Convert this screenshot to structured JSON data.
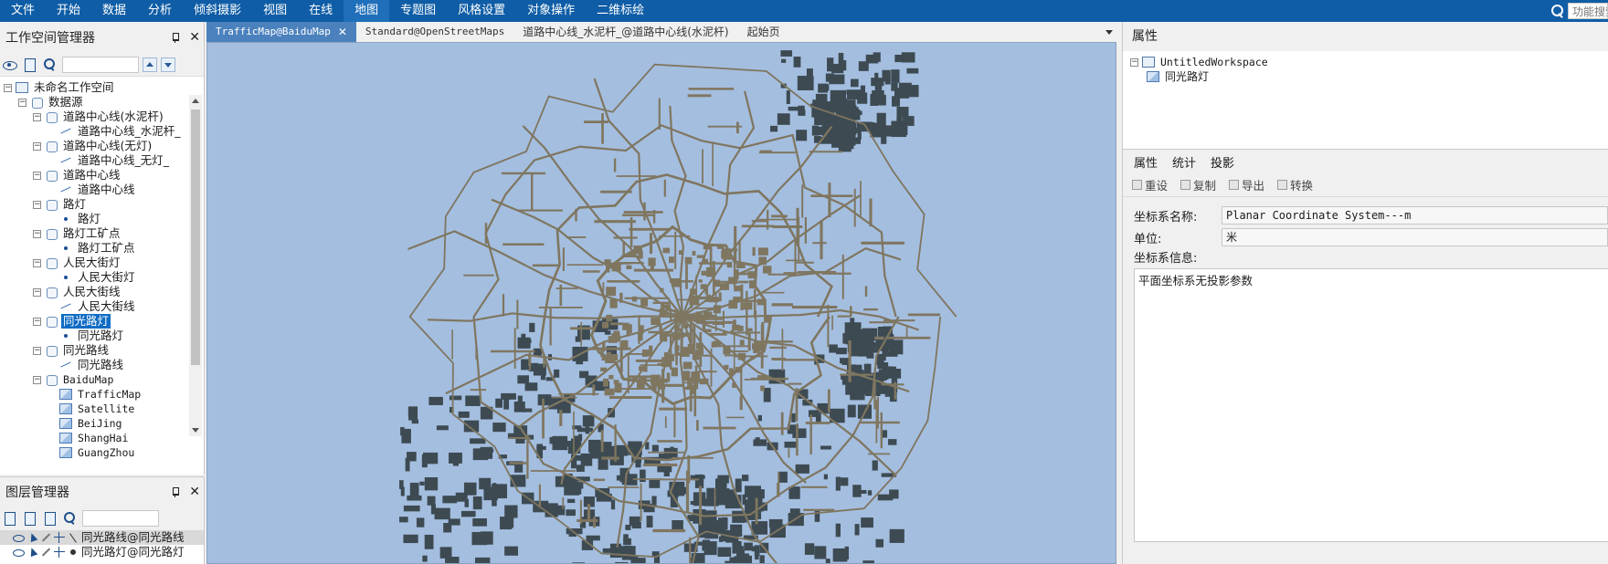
{
  "menubar": {
    "items": [
      "文件",
      "开始",
      "数据",
      "分析",
      "倾斜摄影",
      "视图",
      "在线",
      "地图",
      "专题图",
      "风格设置",
      "对象操作",
      "二维标绘"
    ],
    "active_index": 7,
    "search_placeholder": "功能搜索"
  },
  "workspace_panel": {
    "title": "工作空间管理器",
    "close_glyph": "✕",
    "tree": [
      {
        "level": 0,
        "icon": "workspace-icon",
        "label": "未命名工作空间",
        "expander": "−"
      },
      {
        "level": 1,
        "icon": "datasource-icon",
        "label": "数据源",
        "expander": "−"
      },
      {
        "level": 2,
        "icon": "datasource-icon",
        "label": "道路中心线(水泥杆)",
        "expander": "−"
      },
      {
        "level": 3,
        "icon": "line-dataset-icon",
        "label": "道路中心线_水泥杆_",
        "expander": ""
      },
      {
        "level": 2,
        "icon": "datasource-icon",
        "label": "道路中心线(无灯)",
        "expander": "−"
      },
      {
        "level": 3,
        "icon": "line-dataset-icon",
        "label": "道路中心线_无灯_",
        "expander": ""
      },
      {
        "level": 2,
        "icon": "datasource-icon",
        "label": "道路中心线",
        "expander": "−"
      },
      {
        "level": 3,
        "icon": "line-dataset-icon",
        "label": "道路中心线",
        "expander": ""
      },
      {
        "level": 2,
        "icon": "datasource-icon",
        "label": "路灯",
        "expander": "−"
      },
      {
        "level": 3,
        "icon": "point-dataset-icon",
        "label": "路灯",
        "expander": ""
      },
      {
        "level": 2,
        "icon": "datasource-icon",
        "label": "路灯工矿点",
        "expander": "−"
      },
      {
        "level": 3,
        "icon": "point-dataset-icon",
        "label": "路灯工矿点",
        "expander": ""
      },
      {
        "level": 2,
        "icon": "datasource-icon",
        "label": "人民大街灯",
        "expander": "−"
      },
      {
        "level": 3,
        "icon": "point-dataset-icon",
        "label": "人民大街灯",
        "expander": ""
      },
      {
        "level": 2,
        "icon": "datasource-icon",
        "label": "人民大街线",
        "expander": "−"
      },
      {
        "level": 3,
        "icon": "line-dataset-icon",
        "label": "人民大街线",
        "expander": ""
      },
      {
        "level": 2,
        "icon": "datasource-icon",
        "label": "同光路灯",
        "expander": "−",
        "selected": true
      },
      {
        "level": 3,
        "icon": "point-dataset-icon",
        "label": "同光路灯",
        "expander": ""
      },
      {
        "level": 2,
        "icon": "datasource-icon",
        "label": "同光路线",
        "expander": "−"
      },
      {
        "level": 3,
        "icon": "line-dataset-icon",
        "label": "同光路线",
        "expander": ""
      },
      {
        "level": 2,
        "icon": "datasource-icon",
        "label": "BaiduMap",
        "expander": "−",
        "mono": true
      },
      {
        "level": 3,
        "icon": "raster-dataset-icon",
        "label": "TrafficMap",
        "expander": "",
        "mono": true
      },
      {
        "level": 3,
        "icon": "raster-dataset-icon",
        "label": "Satellite",
        "expander": "",
        "mono": true
      },
      {
        "level": 3,
        "icon": "raster-dataset-icon",
        "label": "BeiJing",
        "expander": "",
        "mono": true
      },
      {
        "level": 3,
        "icon": "raster-dataset-icon",
        "label": "ShangHai",
        "expander": "",
        "mono": true
      },
      {
        "level": 3,
        "icon": "raster-dataset-icon",
        "label": "GuangZhou",
        "expander": "",
        "mono": true
      }
    ]
  },
  "layer_panel": {
    "title": "图层管理器",
    "close_glyph": "✕",
    "layers": [
      {
        "label": "同光路线@同光路线",
        "type_icon": "line-glyph-icon",
        "selected": true
      },
      {
        "label": "同光路灯@同光路灯",
        "type_icon": "point-glyph-icon",
        "selected": false
      }
    ]
  },
  "doc_tabs": [
    {
      "label": "TrafficMap@BaiduMap",
      "active": true,
      "mono": true,
      "close": "✕"
    },
    {
      "label": "Standard@OpenStreetMaps",
      "active": false,
      "mono": true
    },
    {
      "label": "道路中心线_水泥杆_@道路中心线(水泥杆)",
      "active": false
    },
    {
      "label": "起始页",
      "active": false
    }
  ],
  "map": {
    "background_color": "#a4bedf",
    "road_color": "#7f7660",
    "block_color": "#3d4a52"
  },
  "properties_panel": {
    "title": "属性",
    "tree": [
      {
        "label": "UntitledWorkspace",
        "icon": "workspace-icon",
        "expander": "−"
      },
      {
        "label": "同光路灯",
        "icon": "map-icon",
        "expander": ""
      }
    ],
    "tabs": [
      "属性",
      "统计",
      "投影"
    ],
    "active_tab": 2,
    "actions": [
      "重设",
      "复制",
      "导出",
      "转换"
    ],
    "fields": {
      "cs_name_label": "坐标系名称:",
      "cs_name_value": "Planar Coordinate System---m",
      "unit_label": "单位:",
      "unit_value": "米",
      "cs_info_label": "坐标系信息:",
      "cs_info_value": "平面坐标系无投影参数"
    }
  }
}
